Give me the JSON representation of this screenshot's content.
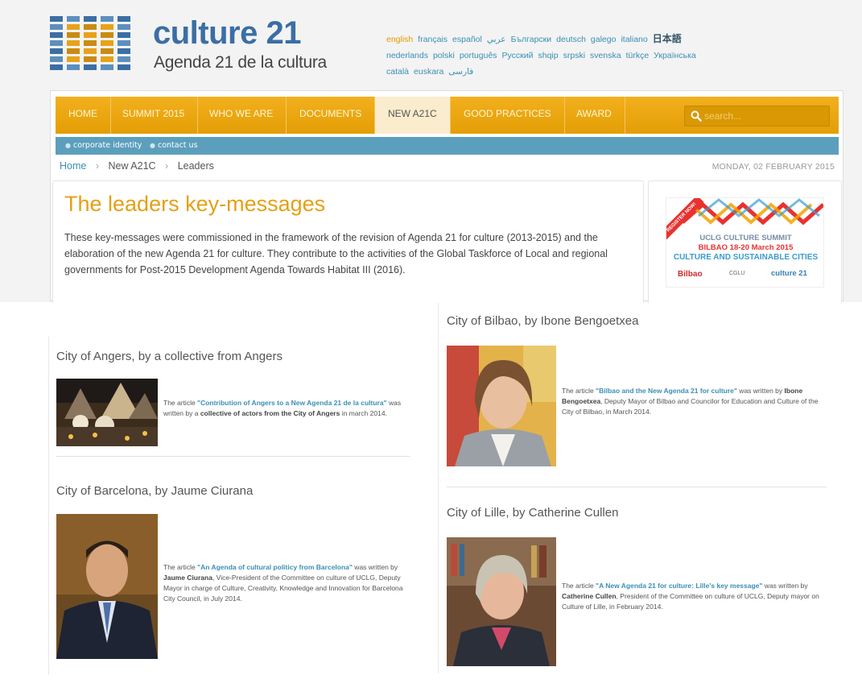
{
  "brand": {
    "title": "culture 21",
    "subtitle": "Agenda 21 de la cultura"
  },
  "languages": [
    {
      "label": "english",
      "active": true
    },
    {
      "label": "français"
    },
    {
      "label": "español"
    },
    {
      "label": "عربي"
    },
    {
      "label": "Български"
    },
    {
      "label": "deutsch"
    },
    {
      "label": "galego"
    },
    {
      "label": "italiano"
    },
    {
      "label": "日本語",
      "big": true
    },
    {
      "label": "nederlands"
    },
    {
      "label": "polski"
    },
    {
      "label": "português"
    },
    {
      "label": "Русский"
    },
    {
      "label": "shqip"
    },
    {
      "label": "srpski"
    },
    {
      "label": "svenska"
    },
    {
      "label": "türkçe"
    },
    {
      "label": "Українська"
    },
    {
      "label": "català"
    },
    {
      "label": "euskara"
    },
    {
      "label": "فارسی"
    }
  ],
  "nav": {
    "items": [
      "HOME",
      "SUMMIT 2015",
      "WHO WE ARE",
      "DOCUMENTS",
      "NEW A21C",
      "GOOD PRACTICES",
      "AWARD"
    ],
    "active": "NEW A21C",
    "search_placeholder": "search..."
  },
  "subnav": [
    "corporate identity",
    "contact us"
  ],
  "breadcrumb": {
    "home": "Home",
    "section": "New A21C",
    "current": "Leaders"
  },
  "date": "MONDAY, 02 FEBRUARY 2015",
  "page": {
    "title": "The leaders key-messages",
    "intro": "These key-messages were commissioned in the framework of the revision of Agenda 21 for culture (2013-2015) and the elaboration of the new Agenda 21 for culture. They contribute to the activities of the Global Taskforce of Local and regional governments for Post-2015 Development Agenda Towards Habitat III (2016)."
  },
  "banner": {
    "ribbon": "REGISTER NOW!",
    "line1": "UCLG CULTURE SUMMIT",
    "line2": "BILBAO 18-20 March 2015",
    "line3": "CULTURE AND SUSTAINABLE CITIES",
    "logo1": "Bilbao",
    "logo2": "CGLU",
    "logo3": "culture 21"
  },
  "items": {
    "angers": {
      "title": "City of Angers, by a collective from Angers",
      "pre": "The article ",
      "link": "\"Contribution of Angers to a New Agenda 21 de la cultura\"",
      "mid": " was written by a ",
      "author": "collective of actors from the City of Angers",
      "post": " in march 2014."
    },
    "barcelona": {
      "title": "City of Barcelona, by Jaume Ciurana",
      "pre": "The article ",
      "link": "\"An Agenda of cultural politicy from Barcelona\"",
      "mid": " was written by ",
      "author": "Jaume Ciurana",
      "post": ", Vice-President of the Committee on culture of UCLG, Deputy Mayor in charge of Culture, Creativity, Knowledge and Innovation for Barcelona City Council, in July 2014."
    },
    "bilbao": {
      "title": "City of Bilbao, by Ibone Bengoetxea",
      "pre": "The article ",
      "link": "\"Bilbao and the New Agenda 21 for culture\"",
      "mid": " was written by ",
      "author": "Ibone Bengoetxea",
      "post": ", Deputy Mayor of Bilbao and Councilor for Education and Culture of the City of Bilbao, in March 2014."
    },
    "lille": {
      "title": "City of Lille, by Catherine Cullen",
      "pre": "The article ",
      "link": "\"A New Agenda 21 for culture: Lille's key message\"",
      "mid": " was written by ",
      "author": "Catherine Cullen",
      "post": ", President of the Committee on culture of UCLG, Deputy mayor on Culture of Lille, in February 2014."
    }
  },
  "colors": {
    "nav_orange": "#e9a50c",
    "subnav_blue": "#5c9fbd",
    "title_orange": "#e5a015",
    "link_blue": "#3b8fb5"
  }
}
